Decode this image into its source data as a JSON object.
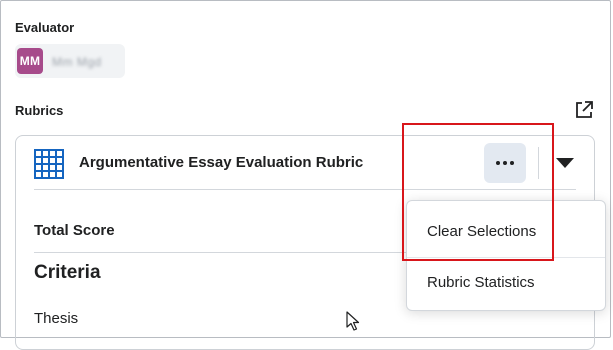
{
  "evaluator": {
    "heading": "Evaluator",
    "avatar_initials": "MM",
    "name": "Mm Mgd"
  },
  "rubrics": {
    "heading": "Rubrics",
    "popout_icon": "external-link-icon",
    "rubric": {
      "icon": "grid-table-icon",
      "title": "Argumentative Essay Evaluation Rubric",
      "total_score_label": "Total Score",
      "criteria_heading": "Criteria",
      "criteria": [
        "Thesis"
      ]
    },
    "actions": {
      "more_icon": "ellipsis-icon",
      "expand_icon": "caret-down-icon"
    }
  },
  "menu": {
    "items": [
      "Clear Selections",
      "Rubric Statistics"
    ]
  },
  "colors": {
    "avatar": "#a74b8b",
    "highlight": "#d8161b",
    "grid_icon": "#1565c0",
    "more_button_bg": "#e3e9f1"
  }
}
